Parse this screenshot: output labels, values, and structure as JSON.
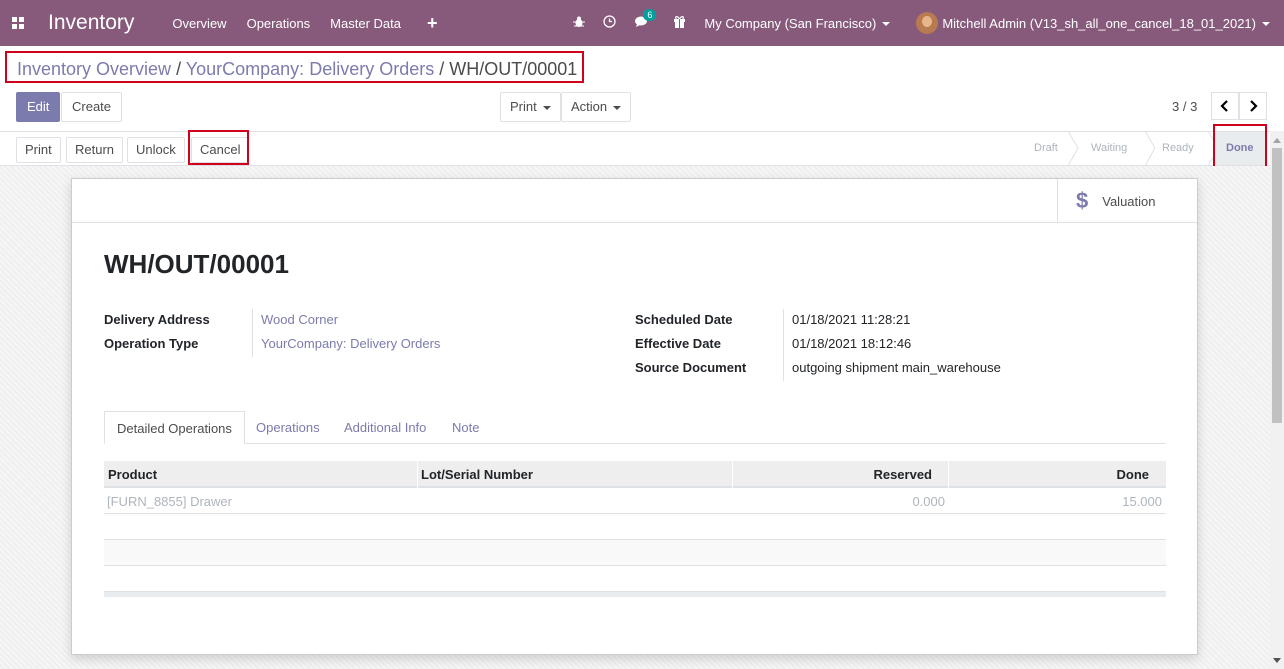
{
  "navbar": {
    "app_title": "Inventory",
    "menu": [
      "Overview",
      "Operations",
      "Master Data"
    ],
    "add_label": "+",
    "chat_badge": "6",
    "company": "My Company (San Francisco)",
    "user": "Mitchell Admin (V13_sh_all_one_cancel_18_01_2021)"
  },
  "breadcrumb": {
    "first": "Inventory Overview",
    "second": "YourCompany: Delivery Orders",
    "current": "WH/OUT/00001",
    "sep": "/"
  },
  "controls": {
    "edit": "Edit",
    "create": "Create",
    "print": "Print",
    "action": "Action",
    "pager": "3 / 3",
    "prev": "‹",
    "next": "›"
  },
  "statusbar": {
    "buttons": [
      "Print",
      "Return",
      "Unlock",
      "Cancel"
    ],
    "stages": [
      "Draft",
      "Waiting",
      "Ready",
      "Done"
    ],
    "active_stage": "Done"
  },
  "sheet": {
    "valuation": "Valuation",
    "title": "WH/OUT/00001",
    "left_fields": [
      {
        "label": "Delivery Address",
        "value": "Wood Corner"
      },
      {
        "label": "Operation Type",
        "value": "YourCompany: Delivery Orders"
      }
    ],
    "right_fields": [
      {
        "label": "Scheduled Date",
        "value": "01/18/2021 11:28:21"
      },
      {
        "label": "Effective Date",
        "value": "01/18/2021 18:12:46"
      },
      {
        "label": "Source Document",
        "value": "outgoing shipment main_warehouse"
      }
    ],
    "tabs": [
      "Detailed Operations",
      "Operations",
      "Additional Info",
      "Note"
    ],
    "table": {
      "headers": [
        "Product",
        "Lot/Serial Number",
        "Reserved",
        "Done"
      ],
      "rows": [
        {
          "product": "[FURN_8855] Drawer",
          "lot": "",
          "reserved": "0.000",
          "done": "15.000"
        }
      ]
    }
  },
  "colors": {
    "brand": "#875a7b",
    "link": "#7c7bad",
    "highlight": "#d0021b"
  }
}
